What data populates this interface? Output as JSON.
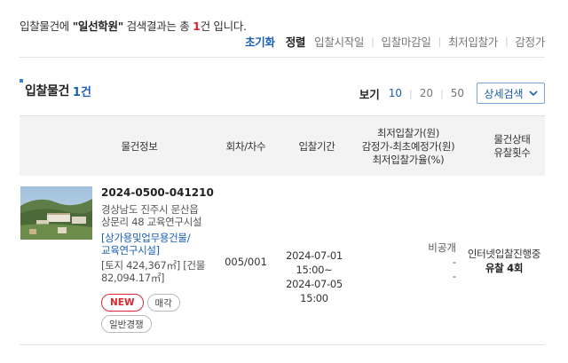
{
  "summary": {
    "prefix": "입찰물건에 ",
    "keyword": "\"일선학원\"",
    "middle": " 검색결과는 총 ",
    "count": "1",
    "suffix": "건 입니다."
  },
  "sort": {
    "reset_label": "초기화",
    "title": "정렬",
    "options": [
      "입찰시작일",
      "입찰마감일",
      "최저입찰가",
      "감정가"
    ]
  },
  "section": {
    "title": "입찰물건",
    "count_label": "1건"
  },
  "view": {
    "label": "보기",
    "options": [
      "10",
      "20",
      "50"
    ],
    "selected": "10",
    "advanced_search_label": "상세검색"
  },
  "table": {
    "headers": {
      "info": "물건정보",
      "round": "회차/차수",
      "period": "입찰기간",
      "price_line1": "최저입찰가(원)",
      "price_line2": "감정가-최초예정가(원)",
      "price_line3": "최저입찰가율(%)",
      "status_line1": "물건상태",
      "status_line2": "유찰횟수"
    },
    "rows": [
      {
        "case_no": "2024-0500-041210",
        "address_line1": "경상남도 진주시 문산읍",
        "address_line2": "상문리 48 교육연구시설",
        "usage_line1": "[상가용및업무용건물/",
        "usage_line2": "교육연구시설]",
        "area_line1": "[토지 424,367㎡] [건물",
        "area_line2": "82,094.17㎡]",
        "badges": [
          "NEW",
          "매각",
          "일반경쟁"
        ],
        "round": "005/001",
        "period_start": "2024-07-01 15:00~",
        "period_end": "2024-07-05 15:00",
        "min_price": "비공개",
        "appraisal": "-",
        "rate": "-",
        "status": "인터넷입찰진행중",
        "fail_count": "유찰 4회"
      }
    ]
  },
  "colors": {
    "accent_blue": "#1a5fb4",
    "new_red": "#d9282f",
    "header_bg": "#f3f3f3"
  }
}
